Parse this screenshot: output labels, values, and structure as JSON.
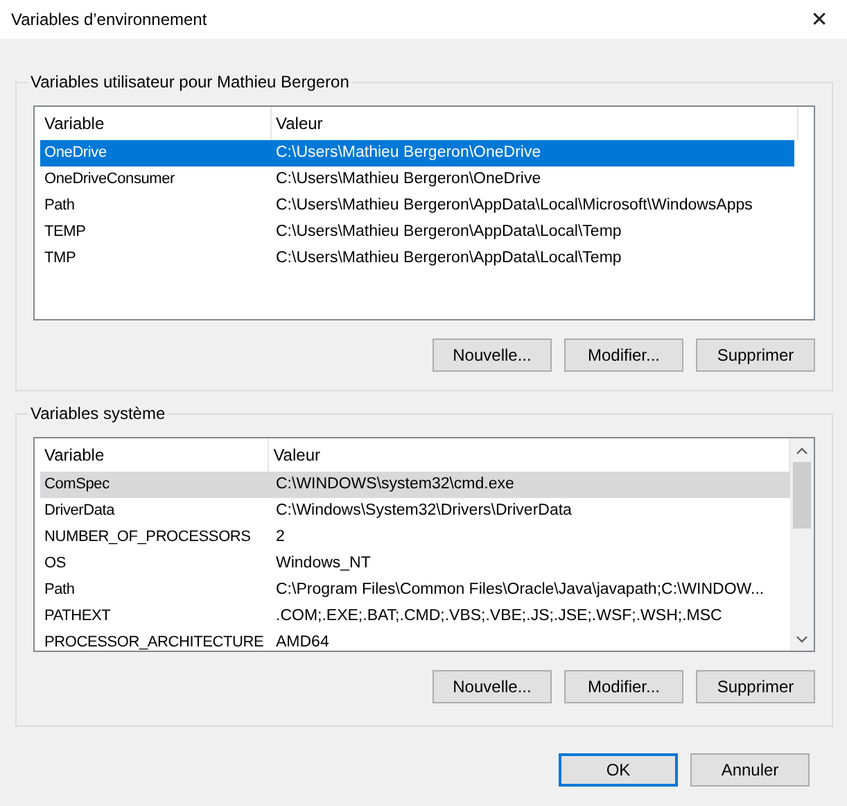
{
  "window": {
    "title": "Variables d’environnement",
    "close": "✕"
  },
  "groups": [
    {
      "title": "Variables utilisateur pour Mathieu Bergeron",
      "focused": true,
      "scrollbar": false,
      "columns": [
        "Variable",
        "Valeur"
      ],
      "rows": [
        {
          "cells": [
            "OneDrive",
            "C:\\Users\\Mathieu Bergeron\\OneDrive"
          ],
          "selected": true
        },
        {
          "cells": [
            "OneDriveConsumer",
            "C:\\Users\\Mathieu Bergeron\\OneDrive"
          ],
          "selected": false
        },
        {
          "cells": [
            "Path",
            "C:\\Users\\Mathieu Bergeron\\AppData\\Local\\Microsoft\\WindowsApps"
          ],
          "selected": false
        },
        {
          "cells": [
            "TEMP",
            "C:\\Users\\Mathieu Bergeron\\AppData\\Local\\Temp"
          ],
          "selected": false
        },
        {
          "cells": [
            "TMP",
            "C:\\Users\\Mathieu Bergeron\\AppData\\Local\\Temp"
          ],
          "selected": false
        }
      ],
      "buttons": [
        "Nouvelle...",
        "Modifier...",
        "Supprimer"
      ]
    },
    {
      "title": "Variables système",
      "focused": false,
      "scrollbar": true,
      "columns": [
        "Variable",
        "Valeur"
      ],
      "rows": [
        {
          "cells": [
            "ComSpec",
            "C:\\WINDOWS\\system32\\cmd.exe"
          ],
          "selected": true
        },
        {
          "cells": [
            "DriverData",
            "C:\\Windows\\System32\\Drivers\\DriverData"
          ],
          "selected": false
        },
        {
          "cells": [
            "NUMBER_OF_PROCESSORS",
            "2"
          ],
          "selected": false
        },
        {
          "cells": [
            "OS",
            "Windows_NT"
          ],
          "selected": false
        },
        {
          "cells": [
            "Path",
            "C:\\Program Files\\Common Files\\Oracle\\Java\\javapath;C:\\WINDOW..."
          ],
          "selected": false
        },
        {
          "cells": [
            "PATHEXT",
            ".COM;.EXE;.BAT;.CMD;.VBS;.VBE;.JS;.JSE;.WSF;.WSH;.MSC"
          ],
          "selected": false
        },
        {
          "cells": [
            "PROCESSOR_ARCHITECTURE",
            "AMD64"
          ],
          "selected": false
        }
      ],
      "buttons": [
        "Nouvelle...",
        "Modifier...",
        "Supprimer"
      ]
    }
  ],
  "footer": [
    {
      "label": "OK",
      "default": true
    },
    {
      "label": "Annuler",
      "default": false
    }
  ]
}
